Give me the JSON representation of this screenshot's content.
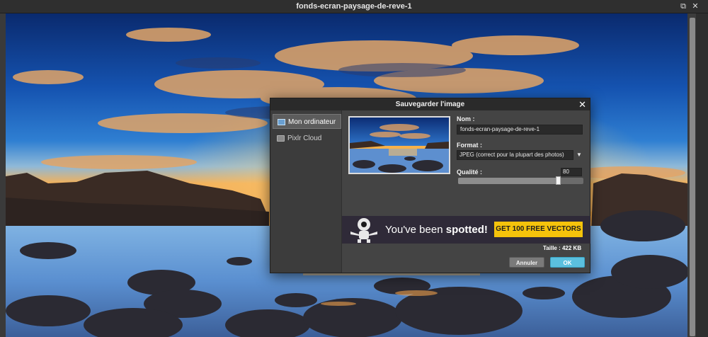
{
  "window": {
    "title": "fonds-ecran-paysage-de-reve-1",
    "restore_glyph": "⧉",
    "close_glyph": "✕",
    "icons": [
      "restore-icon",
      "close-icon"
    ]
  },
  "dialog": {
    "title": "Sauvegarder l'image",
    "close_glyph": "✕",
    "nav": [
      {
        "label": "Mon ordinateur",
        "icon": "computer-icon",
        "active": true
      },
      {
        "label": "Pixlr Cloud",
        "icon": "cloud-icon",
        "active": false
      }
    ],
    "name_label": "Nom :",
    "name_value": "fonds-ecran-paysage-de-reve-1",
    "format_label": "Format :",
    "format_value": "JPEG (correct pour la plupart des photos)",
    "format_arrow": "▼",
    "quality_label": "Qualité :",
    "quality_value": "80",
    "quality_level": 0.8,
    "size_info": "Taille : 422 KB",
    "cancel_label": "Annuler",
    "ok_label": "OK",
    "banner": {
      "text_prefix": "You've been ",
      "text_bold": "spotted!",
      "cta": "GET 100 FREE VECTORS",
      "cta_color": "#f5c30b"
    }
  },
  "colors": {
    "accent_ok": "#5bc0de",
    "titlebar": "#2f2f2f",
    "dialog_bg": "#444444"
  }
}
